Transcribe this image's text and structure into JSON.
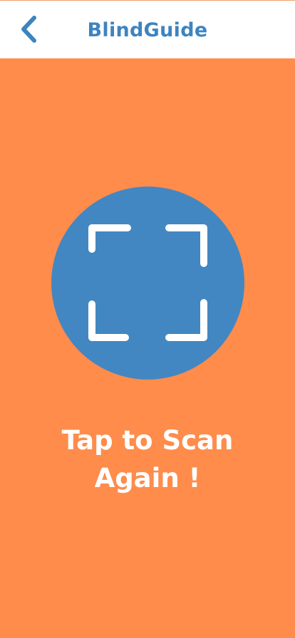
{
  "header": {
    "title": "BlindGuide",
    "back_icon": "chevron-left-icon"
  },
  "main": {
    "scan_icon": "scan-frame-icon",
    "caption_line1": "Tap to Scan",
    "caption_line2": "Again !"
  },
  "colors": {
    "background": "#FF8C4B",
    "accent": "#4287C2",
    "header_bg": "#FFFFFF",
    "text_on_background": "#FFFFFF"
  }
}
